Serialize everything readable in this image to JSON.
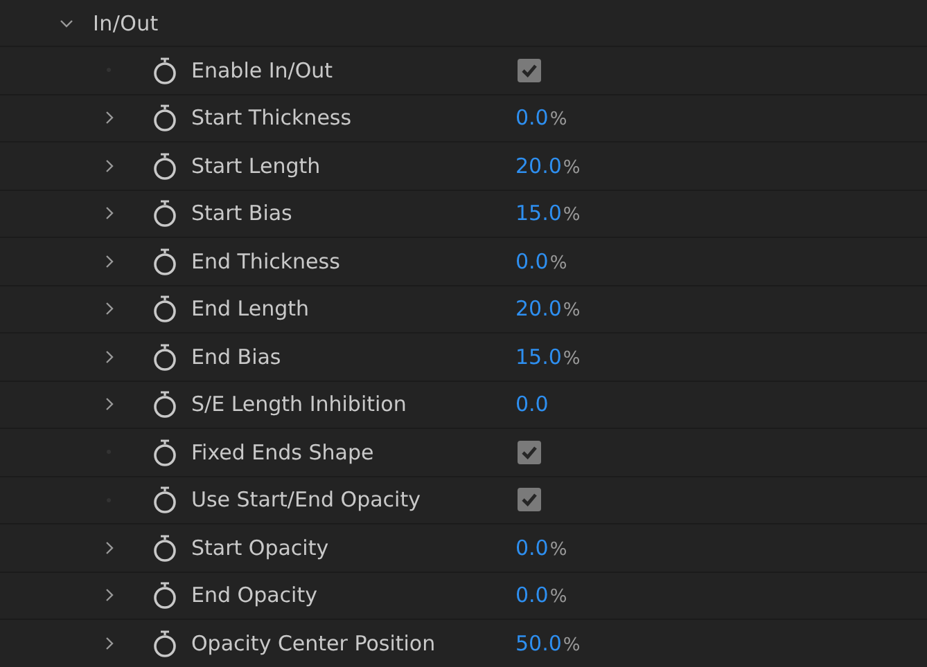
{
  "group": {
    "title": "In/Out",
    "expanded": true
  },
  "properties": [
    {
      "kind": "checkbox",
      "label": "Enable In/Out",
      "checked": true
    },
    {
      "kind": "value",
      "label": "Start Thickness",
      "value": "0.0",
      "unit": "%"
    },
    {
      "kind": "value",
      "label": "Start Length",
      "value": "20.0",
      "unit": "%"
    },
    {
      "kind": "value",
      "label": "Start Bias",
      "value": "15.0",
      "unit": "%"
    },
    {
      "kind": "value",
      "label": "End Thickness",
      "value": "0.0",
      "unit": "%"
    },
    {
      "kind": "value",
      "label": "End Length",
      "value": "20.0",
      "unit": "%"
    },
    {
      "kind": "value",
      "label": "End Bias",
      "value": "15.0",
      "unit": "%"
    },
    {
      "kind": "value",
      "label": "S/E Length Inhibition",
      "value": "0.0"
    },
    {
      "kind": "checkbox",
      "label": "Fixed Ends Shape",
      "checked": true
    },
    {
      "kind": "checkbox",
      "label": "Use Start/End Opacity",
      "checked": true
    },
    {
      "kind": "value",
      "label": "Start Opacity",
      "value": "0.0",
      "unit": "%"
    },
    {
      "kind": "value",
      "label": "End Opacity",
      "value": "0.0",
      "unit": "%"
    },
    {
      "kind": "value",
      "label": "Opacity Center Position",
      "value": "50.0",
      "unit": "%"
    }
  ]
}
